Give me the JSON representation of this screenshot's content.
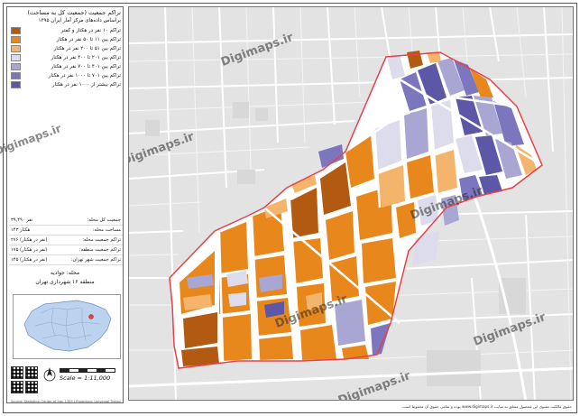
{
  "panel": {
    "title_line1": "تراکم جمعیت (جمعیت کل به مساحت)",
    "title_line2": "براساس داده‌های مرکز آمار ایران ۱۳۹۵",
    "legend": [
      {
        "label": "تراکم ۱۰ نفر در هکتار و کمتر",
        "color": "#b25a12"
      },
      {
        "label": "تراکم بین ۱۱ تا ۵۰ نفر در هکتار",
        "color": "#e8881c"
      },
      {
        "label": "تراکم بین ۵۱ تا ۲۰۰ نفر در هکتار",
        "color": "#f5b46b"
      },
      {
        "label": "تراکم بین ۲۰۱ تا ۴۰۰ نفر در هکتار",
        "color": "#dcdcec"
      },
      {
        "label": "تراکم بین ۴۰۱ تا ۷۰۰ نفر در هکتار",
        "color": "#a9a6d4"
      },
      {
        "label": "تراکم بین ۷۰۱ تا ۱۰۰۰ نفر در هکتار",
        "color": "#7b76bd"
      },
      {
        "label": "تراکم بیشتر از ۱۰۰۰ نفر در هکتار",
        "color": "#5c57a6"
      }
    ],
    "stats": [
      {
        "label": "جمعیت کل محله:",
        "value": "۳۹,۴۹۰ نفر"
      },
      {
        "label": "مساحت محله:",
        "value": "۱۴۳ هکتار"
      },
      {
        "label": "تراکم جمعیت محله:",
        "value": "۲۷۶ (نفر در هکتار)"
      },
      {
        "label": "تراکم جمعیت منطقه:",
        "value": "۱۷۵ (نفر در هکتار)"
      },
      {
        "label": "تراکم جمعیت شهر تهران:",
        "value": "۱۴۵ (نفر در هکتار)"
      }
    ],
    "neighborhood": "محله: جوادیه",
    "district": "منطقه ۱۶ شهرداری تهران",
    "scale": "Scale = 1:11,000",
    "credit": "Source: Statistical Center of Iran 1395 | Projection: Universal Transverse Mercator"
  },
  "map": {
    "watermark": "Digimaps.ir",
    "north_label": "N",
    "colors": {
      "background": "#e3e3e3",
      "boundary": "#e8404a",
      "road": "#ffffff",
      "dark_orange": "#b25a12",
      "orange": "#e8881c",
      "light_orange": "#f5b46b",
      "light_purple": "#dcdcec",
      "mid_purple": "#a9a6d4",
      "purple": "#7b76bd",
      "dark_purple": "#5c57a6"
    }
  },
  "footer": "حقوق مالکیت معنوی این محصول متعلق به سایت www.digimaps.ir بوده و تمامی حقوق آن محفوظ است."
}
